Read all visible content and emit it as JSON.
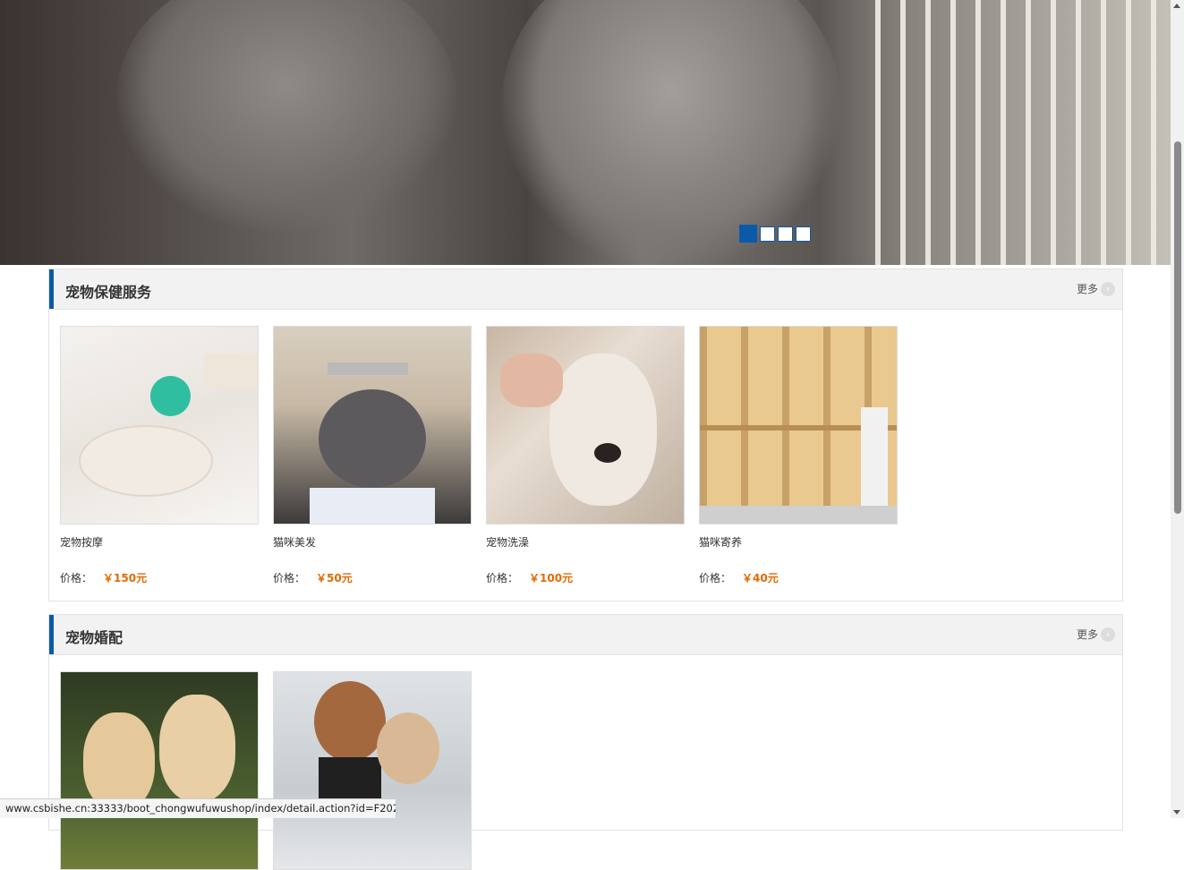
{
  "banner": {
    "alt_icon": "banner-image",
    "dots": [
      "1",
      "2",
      "3",
      "4"
    ],
    "active_dot": 0,
    "accent": "#0b5aa8"
  },
  "sections": [
    {
      "title": "宠物保健服务",
      "more_label": "更多",
      "items": [
        {
          "name": "宠物按摩",
          "price_label": "价格：",
          "price": "￥150元"
        },
        {
          "name": "猫咪美发",
          "price_label": "价格：",
          "price": "￥50元"
        },
        {
          "name": "宠物洗澡",
          "price_label": "价格：",
          "price": "￥100元"
        },
        {
          "name": "猫咪寄养",
          "price_label": "价格：",
          "price": "￥40元"
        }
      ]
    },
    {
      "title": "宠物婚配",
      "more_label": "更多",
      "items": [
        {
          "name": "",
          "price_label": "",
          "price": ""
        },
        {
          "name": "",
          "price_label": "",
          "price": ""
        }
      ]
    }
  ],
  "status_bar": {
    "url": "www.csbishe.cn:33333/boot_chongwufuwushop/index/detail.action?id=F20210..."
  },
  "colors": {
    "accent": "#0b5aa8",
    "price": "#e06a00",
    "header_bg": "#f2f2f2"
  }
}
